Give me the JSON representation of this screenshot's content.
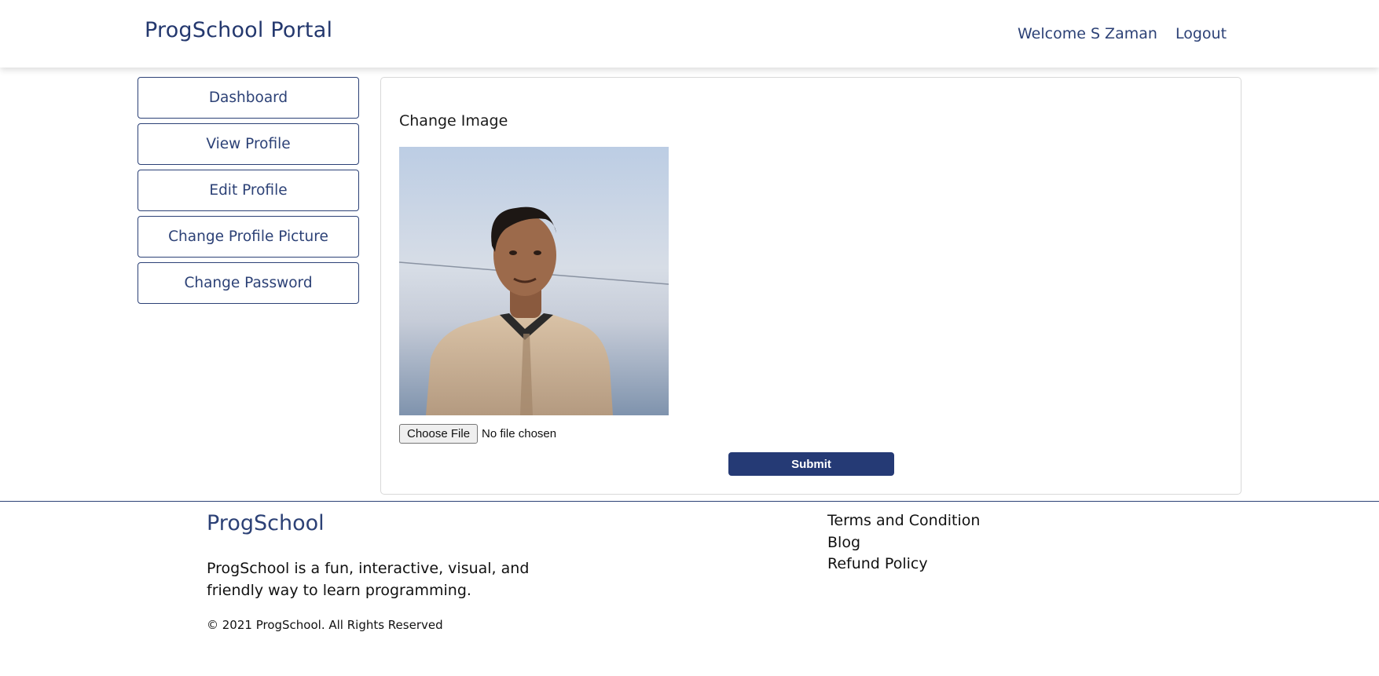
{
  "header": {
    "brand": "ProgSchool Portal",
    "welcome": "Welcome S Zaman",
    "logout_label": "Logout"
  },
  "sidebar": {
    "items": [
      {
        "label": "Dashboard"
      },
      {
        "label": "View Profile"
      },
      {
        "label": "Edit Profile"
      },
      {
        "label": "Change Profile Picture"
      },
      {
        "label": "Change Password"
      }
    ]
  },
  "main": {
    "title": "Change Image",
    "file_input": {
      "button_label": "Choose File",
      "status": "No file chosen"
    },
    "submit_label": "Submit"
  },
  "footer": {
    "brand": "ProgSchool",
    "tagline": "ProgSchool is a fun, interactive, visual, and friendly way to learn programming.",
    "copyright": "© 2021 ProgSchool. All Rights Reserved",
    "links": [
      {
        "label": "Terms and Condition"
      },
      {
        "label": "Blog"
      },
      {
        "label": "Refund Policy"
      }
    ]
  },
  "colors": {
    "brand": "#24386e",
    "accent": "#253a75",
    "border": "#2c4176"
  }
}
